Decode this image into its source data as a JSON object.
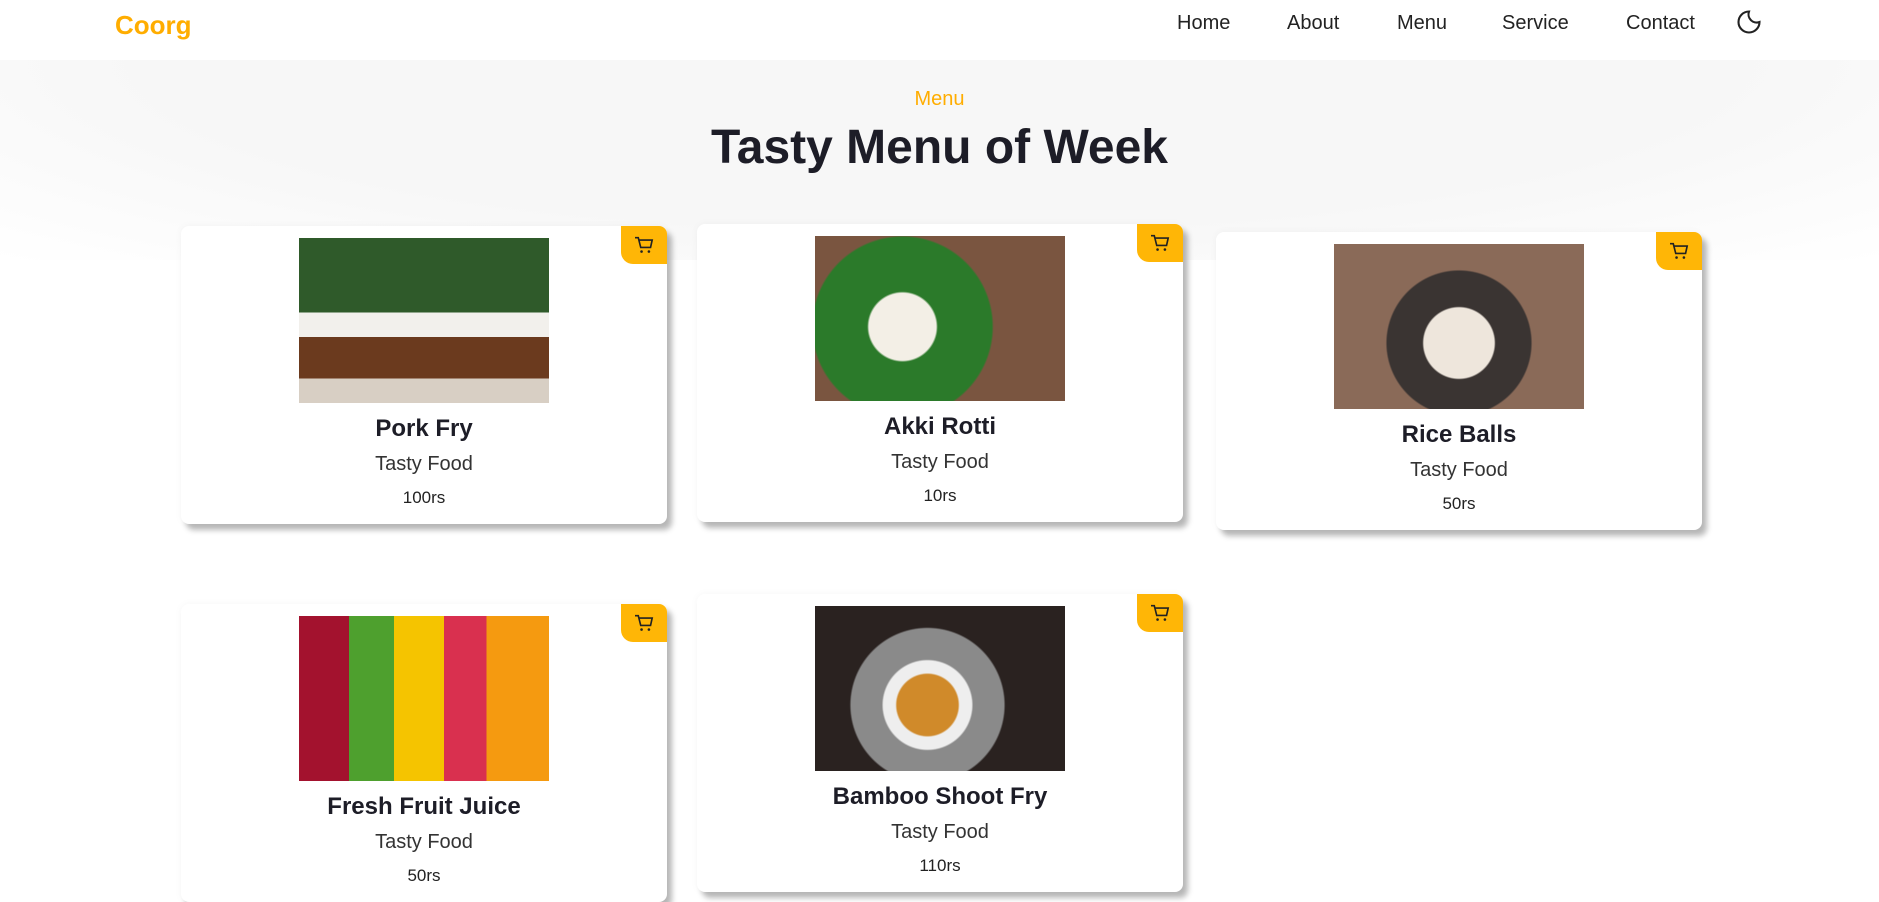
{
  "nav": {
    "logo": "Coorg",
    "items": [
      "Home",
      "About",
      "Menu",
      "Service",
      "Contact"
    ],
    "theme_icon": "moon-icon"
  },
  "section": {
    "subtitle": "Menu",
    "title": "Tasty Menu of Week"
  },
  "colors": {
    "accent": "#ffb606",
    "text": "#1d1d27"
  },
  "items": [
    {
      "name": "Pork Fry",
      "desc": "Tasty Food",
      "price": "100rs"
    },
    {
      "name": "Akki Rotti",
      "desc": "Tasty Food",
      "price": "10rs"
    },
    {
      "name": "Rice Balls",
      "desc": "Tasty Food",
      "price": "50rs"
    },
    {
      "name": "Fresh Fruit Juice",
      "desc": "Tasty Food",
      "price": "50rs"
    },
    {
      "name": "Bamboo Shoot Fry",
      "desc": "Tasty Food",
      "price": "110rs"
    }
  ]
}
